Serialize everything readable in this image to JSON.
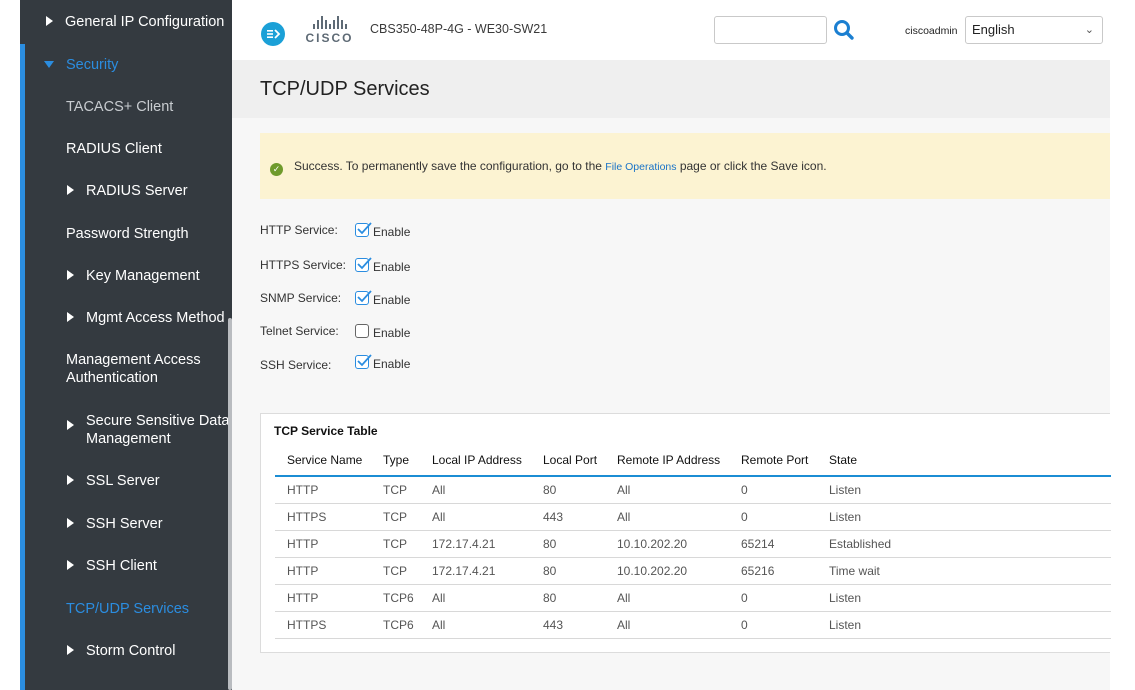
{
  "sidebar": {
    "items": [
      {
        "label": "General IP Configuration",
        "expander": "collapsed",
        "active": false
      },
      {
        "label": "Security",
        "expander": "expanded",
        "active": true
      },
      {
        "label": "TACACS+ Client",
        "expander": "none",
        "active": false
      },
      {
        "label": "RADIUS Client",
        "expander": "none",
        "active": false
      },
      {
        "label": "RADIUS Server",
        "expander": "collapsed",
        "active": false
      },
      {
        "label": "Password Strength",
        "expander": "none",
        "active": false
      },
      {
        "label": "Key Management",
        "expander": "collapsed",
        "active": false
      },
      {
        "label": "Mgmt Access Method",
        "expander": "collapsed",
        "active": false
      },
      {
        "label": "Management Access Authentication",
        "expander": "none",
        "active": false
      },
      {
        "label": "Secure Sensitive Data Management",
        "expander": "collapsed",
        "active": false
      },
      {
        "label": "SSL Server",
        "expander": "collapsed",
        "active": false
      },
      {
        "label": "SSH Server",
        "expander": "collapsed",
        "active": false
      },
      {
        "label": "SSH Client",
        "expander": "collapsed",
        "active": false
      },
      {
        "label": "TCP/UDP Services",
        "expander": "none",
        "active": true
      },
      {
        "label": "Storm Control",
        "expander": "collapsed",
        "active": false
      }
    ]
  },
  "header": {
    "logo_text": "CISCO",
    "device_name": "CBS350-48P-4G - WE30-SW21",
    "search_value": "",
    "username": "ciscoadmin",
    "language": "English",
    "icons": {
      "nav": "nav-toggle-icon",
      "search": "search-icon",
      "dropdown": "chevron-down-icon"
    }
  },
  "page": {
    "title": "TCP/UDP Services",
    "success": {
      "prefix": "Success. To permanently save the configuration, go to the ",
      "link": "File Operations",
      "suffix": " page or click the Save icon."
    },
    "services": [
      {
        "label": "HTTP Service:",
        "enabled": true,
        "checkbox_label": "Enable"
      },
      {
        "label": "HTTPS Service:",
        "enabled": true,
        "checkbox_label": "Enable"
      },
      {
        "label": "SNMP Service:",
        "enabled": true,
        "checkbox_label": "Enable"
      },
      {
        "label": "Telnet Service:",
        "enabled": false,
        "checkbox_label": "Enable"
      },
      {
        "label": "SSH Service:",
        "enabled": true,
        "checkbox_label": "Enable"
      }
    ],
    "tcp_table": {
      "title": "TCP Service Table",
      "columns": [
        "Service Name",
        "Type",
        "Local IP Address",
        "Local Port",
        "Remote IP Address",
        "Remote Port",
        "State"
      ],
      "rows": [
        [
          "HTTP",
          "TCP",
          "All",
          "80",
          "All",
          "0",
          "Listen"
        ],
        [
          "HTTPS",
          "TCP",
          "All",
          "443",
          "All",
          "0",
          "Listen"
        ],
        [
          "HTTP",
          "TCP",
          "172.17.4.21",
          "80",
          "10.10.202.20",
          "65214",
          "Established"
        ],
        [
          "HTTP",
          "TCP",
          "172.17.4.21",
          "80",
          "10.10.202.20",
          "65216",
          "Time wait"
        ],
        [
          "HTTP",
          "TCP6",
          "All",
          "80",
          "All",
          "0",
          "Listen"
        ],
        [
          "HTTPS",
          "TCP6",
          "All",
          "443",
          "All",
          "0",
          "Listen"
        ]
      ]
    }
  },
  "colors": {
    "sidebar_bg": "#343a40",
    "accent": "#2b8de0",
    "success_bg": "#fcf3d2",
    "success_icon": "#6f9a2c",
    "table_header_rule": "#1b8dd4"
  }
}
